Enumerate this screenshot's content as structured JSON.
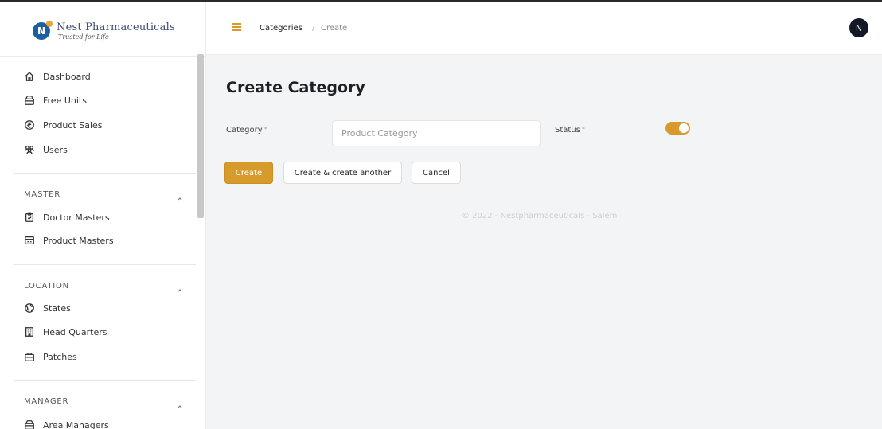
{
  "brand": {
    "logo_letter": "N",
    "name": "Nest Pharmaceuticals",
    "tagline": "Trusted for Life"
  },
  "sidebar": {
    "items": [
      {
        "label": "Dashboard",
        "icon": "home-icon"
      },
      {
        "label": "Free Units",
        "icon": "package-icon"
      },
      {
        "label": "Product Sales",
        "icon": "rupee-circle-icon"
      },
      {
        "label": "Users",
        "icon": "users-icon"
      }
    ],
    "groups": [
      {
        "title": "MASTER",
        "items": [
          {
            "label": "Doctor Masters",
            "icon": "clipboard-icon"
          },
          {
            "label": "Product Masters",
            "icon": "product-icon"
          }
        ]
      },
      {
        "title": "LOCATION",
        "items": [
          {
            "label": "States",
            "icon": "globe-icon"
          },
          {
            "label": "Head Quarters",
            "icon": "building-icon"
          },
          {
            "label": "Patches",
            "icon": "briefcase-icon"
          }
        ]
      },
      {
        "title": "MANAGER",
        "items": [
          {
            "label": "Area Managers",
            "icon": "package-icon"
          }
        ]
      }
    ]
  },
  "header": {
    "breadcrumb": [
      "Categories",
      "/",
      "Create"
    ],
    "avatar_initial": "N"
  },
  "main": {
    "title": "Create Category",
    "form": {
      "category_label": "Category",
      "category_placeholder": "Product Category",
      "status_label": "Status",
      "required_mark": "*",
      "status_on": true
    },
    "buttons": {
      "create": "Create",
      "create_another": "Create & create another",
      "cancel": "Cancel"
    },
    "footer": "© 2022 - Nestpharmaceuticals - Salem"
  },
  "colors": {
    "accent": "#d69b2b",
    "avatar_bg": "#121826",
    "page_bg": "#f3f4f6"
  }
}
